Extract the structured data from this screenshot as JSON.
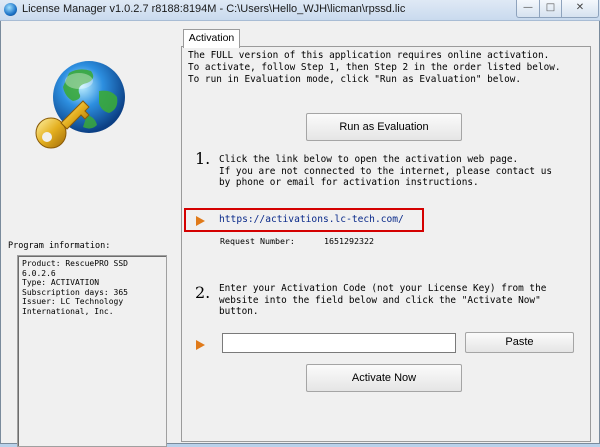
{
  "window": {
    "title": "License Manager v1.0.2.7 r8188:8194M - C:\\Users\\Hello_WJH\\licman\\rpssd.lic",
    "controls": {
      "minimize": "—",
      "maximize": "□",
      "close": "✕"
    }
  },
  "program_info": {
    "label": "Program information:",
    "text": "Product: RescuePRO SSD\n6.0.2.6\nType: ACTIVATION\nSubscription days: 365\nIssuer: LC Technology\nInternational, Inc."
  },
  "tabs": [
    {
      "label": "Activation",
      "active": true
    }
  ],
  "activation": {
    "intro": "The FULL version of this application requires online activation.\nTo activate, follow Step 1, then Step 2 in the order listed below.\nTo run in Evaluation mode, click \"Run as Evaluation\" below.",
    "run_eval_label": "Run as Evaluation",
    "step1": {
      "number": "1.",
      "text": "Click the link below to open the activation web page.\nIf you are not connected to the internet, please contact us\nby phone or email for activation instructions.",
      "link": "https://activations.lc-tech.com/",
      "request_label": "Request Number:",
      "request_number": "1651292322"
    },
    "step2": {
      "number": "2.",
      "text": "Enter your Activation Code (not your License Key) from the\nwebsite into the field below and click the \"Activate Now\"\nbutton.",
      "code_value": "",
      "paste_label": "Paste",
      "activate_label": "Activate Now"
    }
  },
  "colors": {
    "arrow": "#e07a1a",
    "highlight_border": "#d40000",
    "link": "#0a2a8a"
  },
  "icons": {
    "title": "globe-icon",
    "logo": "globe-key-logo",
    "step_arrow": "arrow-right-icon"
  }
}
